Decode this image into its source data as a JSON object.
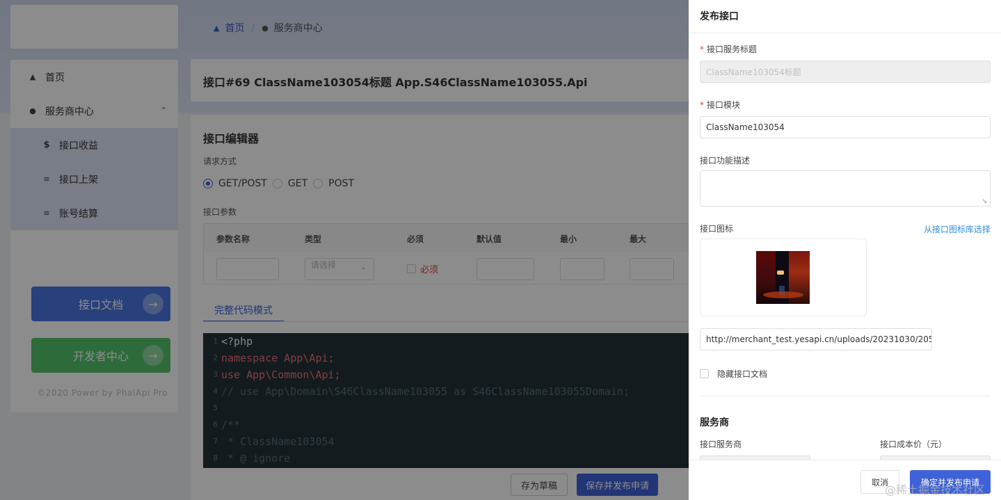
{
  "sidebar": {
    "items": [
      {
        "label": "首页",
        "icon": "home-icon"
      },
      {
        "label": "服务商中心",
        "icon": "user-icon",
        "expanded": true
      }
    ],
    "sub_items": [
      {
        "label": "接口收益",
        "icon": "dollar-icon"
      },
      {
        "label": "接口上架",
        "icon": "list-icon"
      },
      {
        "label": "账号结算",
        "icon": "list-icon"
      }
    ],
    "doc_button": "接口文档",
    "dev_button": "开发者中心",
    "copyright": "©2020 Power by PhalApi Pro"
  },
  "breadcrumb": {
    "home": "首页",
    "current": "服务商中心"
  },
  "page_title": "接口#69  ClassName103054标题  App.S46ClassName103055.Api",
  "editor": {
    "title": "接口编辑器",
    "method_label": "请求方式",
    "methods": [
      {
        "label": "GET/POST",
        "selected": true
      },
      {
        "label": "GET",
        "selected": false
      },
      {
        "label": "POST",
        "selected": false
      }
    ],
    "params_label": "接口参数",
    "columns": [
      "参数名称",
      "类型",
      "必须",
      "默认值",
      "最小",
      "最大"
    ],
    "type_placeholder": "请选择",
    "required_label": "必须",
    "tab": "完整代码模式",
    "code_lines": [
      {
        "n": "1",
        "text": "<?php"
      },
      {
        "n": "2",
        "text": "namespace App\\Api;"
      },
      {
        "n": "3",
        "text": "use App\\Common\\Api;"
      },
      {
        "n": "4",
        "text": "// use App\\Domain\\S46ClassName103055 as S46ClassName103055Domain;"
      },
      {
        "n": "5",
        "text": ""
      },
      {
        "n": "6",
        "text": "/**"
      },
      {
        "n": "7",
        "text": " * ClassName103054"
      },
      {
        "n": "8",
        "text": " * @ ignore"
      }
    ],
    "draft_button": "存为草稿",
    "save_publish_button": "保存并发布申请"
  },
  "drawer": {
    "title": "发布接口",
    "service_title_label": "接口服务标题",
    "service_title_value": "ClassName103054标题",
    "module_label": "接口模块",
    "module_value": "ClassName103054",
    "desc_label": "接口功能描述",
    "desc_value": "",
    "icon_label": "接口图标",
    "icon_link": "从接口图标库选择",
    "icon_url": "http://merchant_test.yesapi.cn/uploads/20231030/205548_",
    "hide_doc_label": "隐藏接口文档",
    "section_title": "服务商",
    "provider_label": "接口服务商",
    "cost_label": "接口成本价（元）",
    "cancel": "取消",
    "confirm": "确定并发布申请"
  },
  "watermark": "@稀土掘金技术社区",
  "colors": {
    "primary": "#3f62d8",
    "success": "#52c46c",
    "danger": "#e0443a",
    "link": "#2b8fe6"
  }
}
